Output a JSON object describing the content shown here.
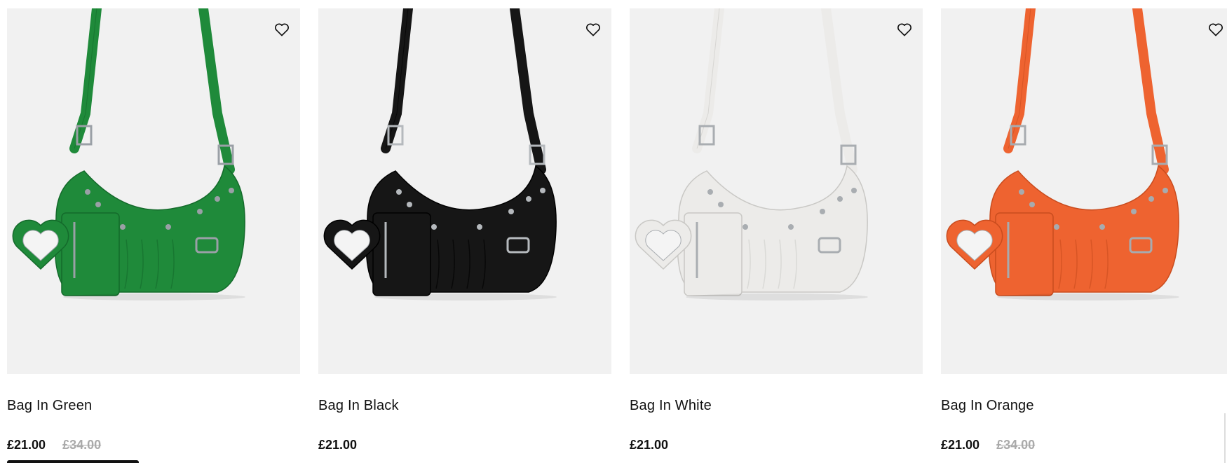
{
  "products": [
    {
      "name": "Bag In Green",
      "price": "£21.00",
      "was_price": "£34.00",
      "color": "#1f8a3a",
      "dark": "#146a2b",
      "hardware": "#9aa0a6",
      "wishlist_icon": "heart-outline-icon"
    },
    {
      "name": "Bag In Black",
      "price": "£21.00",
      "was_price": "",
      "color": "#161616",
      "dark": "#000000",
      "hardware": "#b5b9bd",
      "wishlist_icon": "heart-outline-icon"
    },
    {
      "name": "Bag In White",
      "price": "£21.00",
      "was_price": "",
      "color": "#ecebe9",
      "dark": "#cfcecb",
      "hardware": "#a9adb1",
      "wishlist_icon": "heart-outline-icon"
    },
    {
      "name": "Bag In Orange",
      "price": "£21.00",
      "was_price": "£34.00",
      "color": "#ee6330",
      "dark": "#c94c1e",
      "hardware": "#a7abaf",
      "wishlist_icon": "heart-outline-icon"
    }
  ]
}
